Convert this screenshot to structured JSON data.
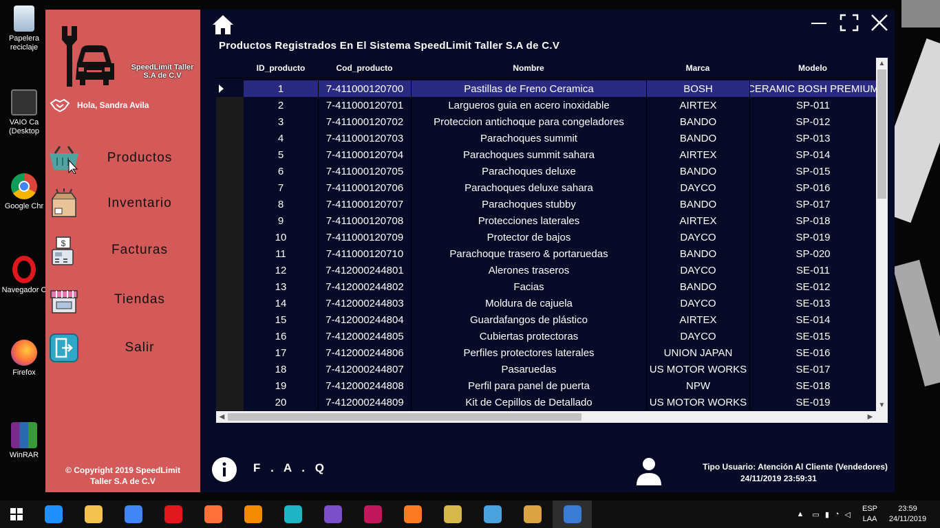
{
  "desktop": {
    "icons": [
      {
        "label": "Papelera\nreciclaje",
        "icon": "recycle-bin-icon"
      },
      {
        "label": "VAIO Ca\n(Desktop",
        "icon": "vaio-icon"
      },
      {
        "label": "Google Chr",
        "icon": "chrome-icon"
      },
      {
        "label": "Navegador C",
        "icon": "opera-icon"
      },
      {
        "label": "Firefox",
        "icon": "firefox-icon"
      },
      {
        "label": "WinRAR",
        "icon": "winrar-icon"
      }
    ]
  },
  "sidebar": {
    "logo_text": "SpeedLimit Taller\nS.A de C.V",
    "greeting": "Hola, Sandra Avila",
    "nav": [
      {
        "label": "Productos",
        "icon": "shopping-basket-icon"
      },
      {
        "label": "Inventario",
        "icon": "box-icon"
      },
      {
        "label": "Facturas",
        "icon": "cash-register-icon"
      },
      {
        "label": "Tiendas",
        "icon": "store-icon"
      },
      {
        "label": "Salir",
        "icon": "exit-icon"
      }
    ],
    "copyright": "© Copyright 2019 SpeedLimit\nTaller S.A de C.V"
  },
  "main": {
    "title": "Productos Registrados En El Sistema SpeedLimit Taller S.A de C.V",
    "columns": [
      "ID_producto",
      "Cod_producto",
      "Nombre",
      "Marca",
      "Modelo"
    ],
    "selected_row": 0,
    "rows": [
      [
        "1",
        "7-411000120700",
        "Pastillas de Freno Ceramica",
        "BOSH",
        "CERAMIC BOSH PREMIUM"
      ],
      [
        "2",
        "7-411000120701",
        "Largueros guia en acero inoxidable",
        "AIRTEX",
        "SP-011"
      ],
      [
        "3",
        "7-411000120702",
        "Proteccion antichoque para congeladores",
        "BANDO",
        "SP-012"
      ],
      [
        "4",
        "7-411000120703",
        "Parachoques summit",
        "BANDO",
        "SP-013"
      ],
      [
        "5",
        "7-411000120704",
        "Parachoques summit sahara",
        "AIRTEX",
        "SP-014"
      ],
      [
        "6",
        "7-411000120705",
        "Parachoques deluxe",
        "BANDO",
        "SP-015"
      ],
      [
        "7",
        "7-411000120706",
        "Parachoques deluxe sahara",
        "DAYCO",
        "SP-016"
      ],
      [
        "8",
        "7-411000120707",
        "Parachoques stubby",
        "BANDO",
        "SP-017"
      ],
      [
        "9",
        "7-411000120708",
        "Protecciones laterales",
        "AIRTEX",
        "SP-018"
      ],
      [
        "10",
        "7-411000120709",
        "Protector de bajos",
        "DAYCO",
        "SP-019"
      ],
      [
        "11",
        "7-411000120710",
        "Parachoque trasero & portaruedas",
        "BANDO",
        "SP-020"
      ],
      [
        "12",
        "7-412000244801",
        "Alerones traseros",
        "DAYCO",
        "SE-011"
      ],
      [
        "13",
        "7-412000244802",
        "Facias",
        "BANDO",
        "SE-012"
      ],
      [
        "14",
        "7-412000244803",
        "Moldura de cajuela",
        "DAYCO",
        "SE-013"
      ],
      [
        "15",
        "7-412000244804",
        "Guardafangos de plástico",
        "AIRTEX",
        "SE-014"
      ],
      [
        "16",
        "7-412000244805",
        "Cubiertas protectoras",
        "DAYCO",
        "SE-015"
      ],
      [
        "17",
        "7-412000244806",
        "Perfiles protectores laterales",
        "UNION JAPAN",
        "SE-016"
      ],
      [
        "18",
        "7-412000244807",
        "Pasaruedas",
        "US MOTOR WORKS",
        "SE-017"
      ],
      [
        "19",
        "7-412000244808",
        "Perfil para panel de puerta",
        "NPW",
        "SE-018"
      ],
      [
        "20",
        "7-412000244809",
        "Kit de Cepillos de Detallado",
        "US MOTOR WORKS",
        "SE-019"
      ]
    ]
  },
  "footer": {
    "faq": "F . A . Q",
    "user_type": "Tipo Usuario: Atención Al Cliente (Vendedores)",
    "datetime": "24/11/2019 23:59:31"
  },
  "taskbar": {
    "apps": [
      "edge-icon",
      "file-explorer-icon",
      "chrome-icon",
      "opera-icon",
      "firefox-icon",
      "sublime-text-icon",
      "app-icon",
      "visual-studio-icon",
      "app-icon",
      "xampp-icon",
      "tools-icon",
      "app-icon",
      "paint-icon",
      "speedlimit-app-icon"
    ],
    "active_index": 13,
    "lang": "ESP",
    "lang_sub": "LAA",
    "time": "23:59",
    "date": "24/11/2019"
  },
  "colors": {
    "sidebar": "#d45a5a",
    "app_bg": "#070a26",
    "selected_row": "#2a2a82"
  }
}
